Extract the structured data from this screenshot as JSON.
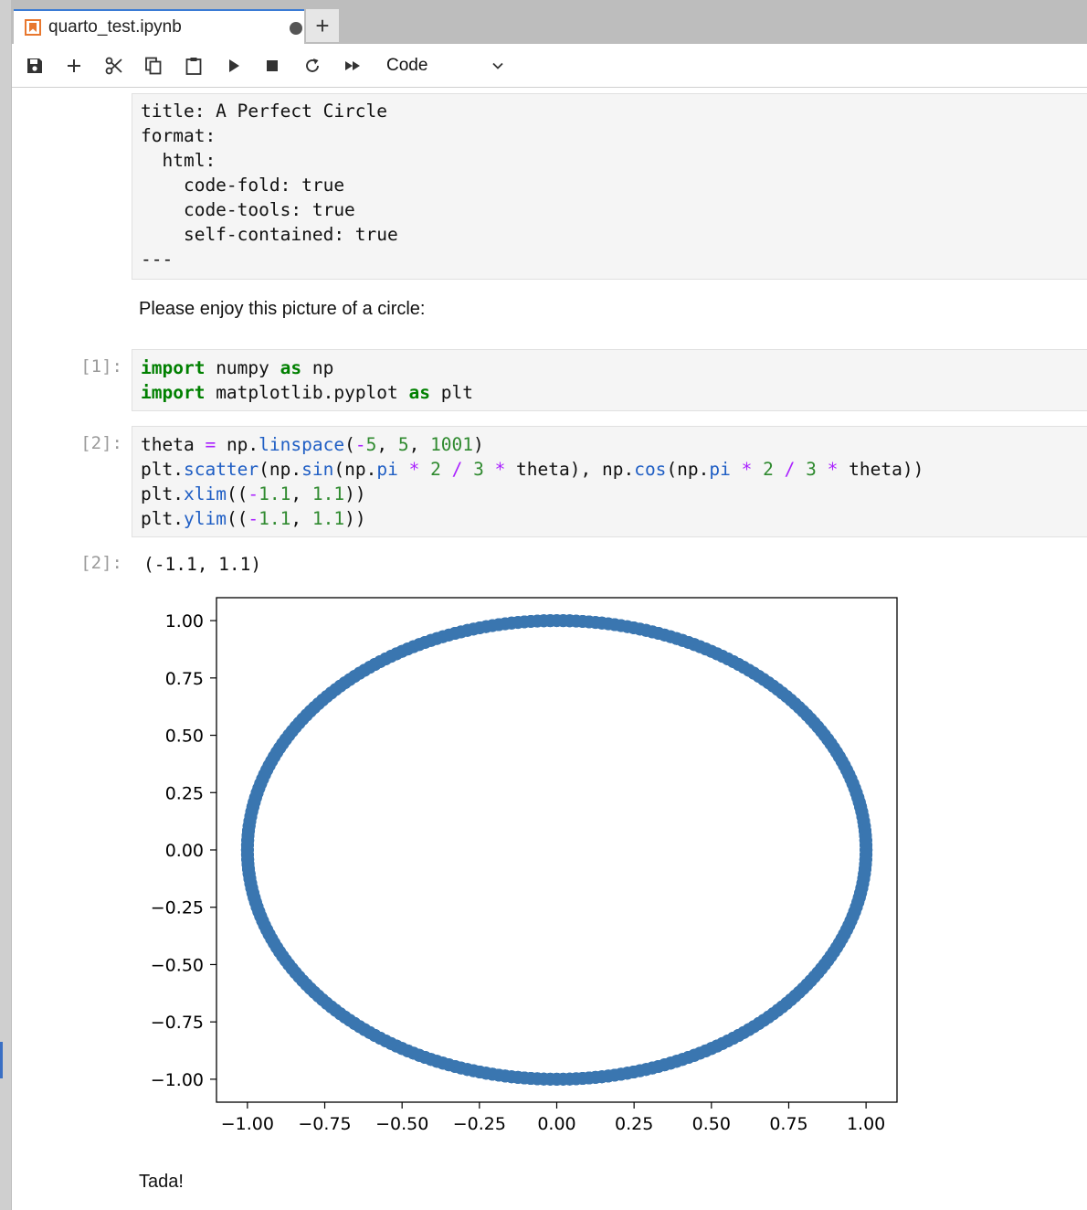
{
  "tabs": {
    "notebook_tab": {
      "label": "quarto_test.ipynb"
    },
    "new_tab_label": "+"
  },
  "toolbar": {
    "icons": [
      "save-icon",
      "add-icon",
      "scissors-icon",
      "copy-icon",
      "paste-icon",
      "run-icon",
      "stop-icon",
      "restart-icon",
      "fast-forward-icon",
      "chevron-down-icon"
    ],
    "cell_type": "Code"
  },
  "cells": {
    "raw_lines": [
      "title: A Perfect Circle",
      "format:",
      "  html:",
      "    code-fold: true",
      "    code-tools: true",
      "    self-contained: true",
      "---"
    ],
    "markdown_1": "Please enjoy this picture of a circle:",
    "prompt_1": "[1]:",
    "prompt_2": "[2]:",
    "output_prompt_2": "[2]:",
    "output_text_2": "(-1.1, 1.1)",
    "markdown_2": "Tada!"
  },
  "colors": {
    "scatter": "#3a76b0",
    "tab_accent": "#3a7bd5",
    "keyword": "#008000",
    "operator": "#aa22ff",
    "number": "#2f8a2f",
    "function": "#1f5ec4"
  },
  "chart_data": {
    "type": "scatter",
    "description_source": "plt.scatter(sin(2πθ/3), cos(2πθ/3)) with theta = linspace(-5, 5, 1001)",
    "n_points": 1001,
    "theta_range": [
      -5,
      5
    ],
    "xlim": [
      -1.1,
      1.1
    ],
    "ylim": [
      -1.1,
      1.1
    ],
    "x_ticks": [
      -1.0,
      -0.75,
      -0.5,
      -0.25,
      0.0,
      0.25,
      0.5,
      0.75,
      1.0
    ],
    "y_ticks": [
      -1.0,
      -0.75,
      -0.5,
      -0.25,
      0.0,
      0.25,
      0.5,
      0.75,
      1.0
    ],
    "x_tick_labels": [
      "−1.00",
      "−0.75",
      "−0.50",
      "−0.25",
      "0.00",
      "0.25",
      "0.50",
      "0.75",
      "1.00"
    ],
    "y_tick_labels": [
      "−1.00",
      "−0.75",
      "−0.50",
      "−0.25",
      "0.00",
      "0.25",
      "0.50",
      "0.75",
      "1.00"
    ],
    "title": "",
    "xlabel": "",
    "ylabel": "",
    "grid": false
  }
}
